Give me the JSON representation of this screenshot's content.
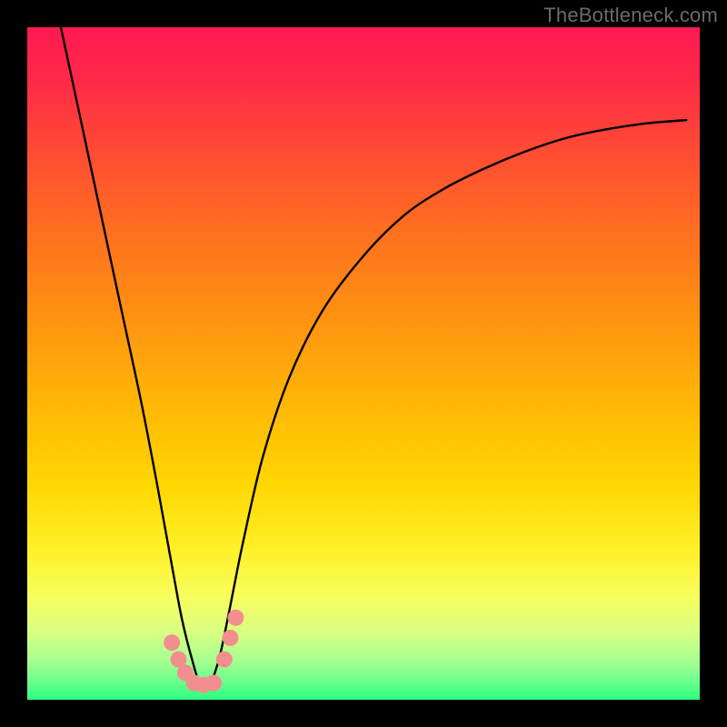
{
  "watermark": "TheBottleneck.com",
  "gradient": {
    "stops": [
      {
        "offset": 0.0,
        "color": "#ff1a52"
      },
      {
        "offset": 0.08,
        "color": "#ff2a47"
      },
      {
        "offset": 0.18,
        "color": "#ff4a34"
      },
      {
        "offset": 0.3,
        "color": "#ff6e21"
      },
      {
        "offset": 0.42,
        "color": "#ff8f12"
      },
      {
        "offset": 0.55,
        "color": "#ffb407"
      },
      {
        "offset": 0.68,
        "color": "#ffd702"
      },
      {
        "offset": 0.78,
        "color": "#fff12a"
      },
      {
        "offset": 0.85,
        "color": "#f6ff60"
      },
      {
        "offset": 0.9,
        "color": "#d8ff83"
      },
      {
        "offset": 0.94,
        "color": "#a9ff90"
      },
      {
        "offset": 0.97,
        "color": "#72ff8e"
      },
      {
        "offset": 1.0,
        "color": "#2dff81"
      }
    ]
  },
  "chart_data": {
    "type": "line",
    "title": "",
    "xlabel": "",
    "ylabel": "",
    "xlim": [
      0,
      1
    ],
    "ylim": [
      0,
      1
    ],
    "notes": "V-shaped bottleneck curve on rainbow heat gradient; minimum near x≈0.26; axes unlabeled; coordinates normalized.",
    "series": [
      {
        "name": "bottleneck-curve",
        "color": "#000000",
        "x": [
          0.05,
          0.08,
          0.11,
          0.14,
          0.17,
          0.195,
          0.215,
          0.23,
          0.245,
          0.258,
          0.27,
          0.285,
          0.3,
          0.32,
          0.35,
          0.39,
          0.44,
          0.5,
          0.56,
          0.62,
          0.68,
          0.74,
          0.8,
          0.86,
          0.92,
          0.98
        ],
        "y": [
          1.0,
          0.86,
          0.72,
          0.58,
          0.44,
          0.31,
          0.2,
          0.12,
          0.06,
          0.02,
          0.02,
          0.06,
          0.13,
          0.23,
          0.36,
          0.48,
          0.58,
          0.66,
          0.72,
          0.76,
          0.79,
          0.815,
          0.835,
          0.848,
          0.857,
          0.862
        ]
      }
    ],
    "markers": {
      "name": "highlight-dots",
      "color": "#f28e8e",
      "radius_px": 9,
      "points": [
        {
          "x": 0.215,
          "y": 0.085
        },
        {
          "x": 0.225,
          "y": 0.06
        },
        {
          "x": 0.235,
          "y": 0.04
        },
        {
          "x": 0.248,
          "y": 0.025
        },
        {
          "x": 0.262,
          "y": 0.022
        },
        {
          "x": 0.277,
          "y": 0.025
        },
        {
          "x": 0.293,
          "y": 0.06
        },
        {
          "x": 0.302,
          "y": 0.092
        },
        {
          "x": 0.31,
          "y": 0.122
        }
      ]
    }
  }
}
